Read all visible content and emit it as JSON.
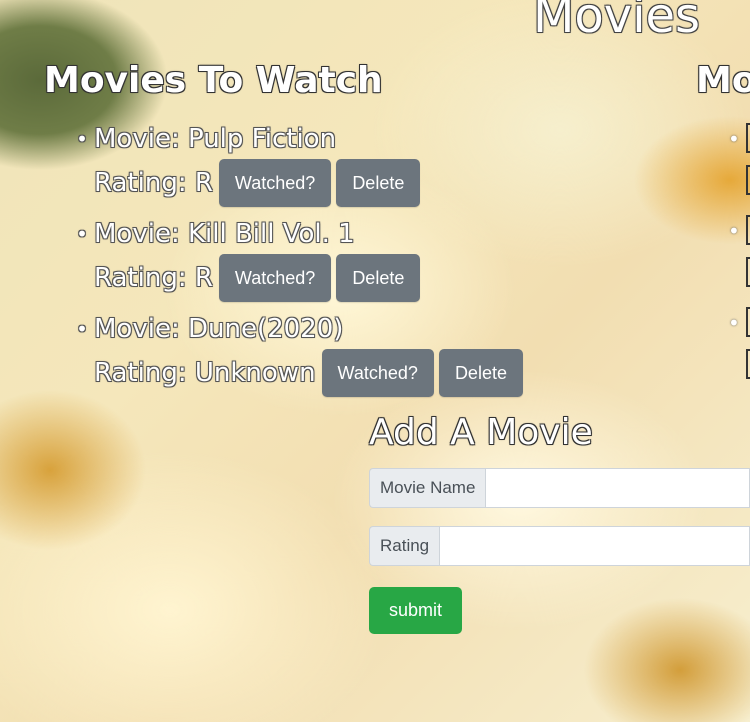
{
  "page": {
    "title": "Movies"
  },
  "to_watch": {
    "heading": "Movies To Watch",
    "items": [
      {
        "movie": "Movie: Pulp Fiction",
        "rating": "Rating: R",
        "watched_label": "Watched?",
        "delete_label": "Delete"
      },
      {
        "movie": "Movie: Kill Bill Vol. 1",
        "rating": "Rating: R",
        "watched_label": "Watched?",
        "delete_label": "Delete"
      },
      {
        "movie": "Movie: Dune(2020)",
        "rating": "Rating: Unknown",
        "watched_label": "Watched?",
        "delete_label": "Delete"
      }
    ]
  },
  "watched": {
    "heading": "Mo"
  },
  "add_movie": {
    "heading": "Add A Movie",
    "movie_name_label": "Movie Name",
    "movie_name_value": "",
    "rating_label": "Rating",
    "rating_value": "",
    "submit_label": "submit"
  },
  "colors": {
    "secondary_button": "#6c757d",
    "submit_button": "#28a745",
    "input_addon": "#e9ecef"
  },
  "icons": {
    "list_bullet": "bullet-icon"
  }
}
